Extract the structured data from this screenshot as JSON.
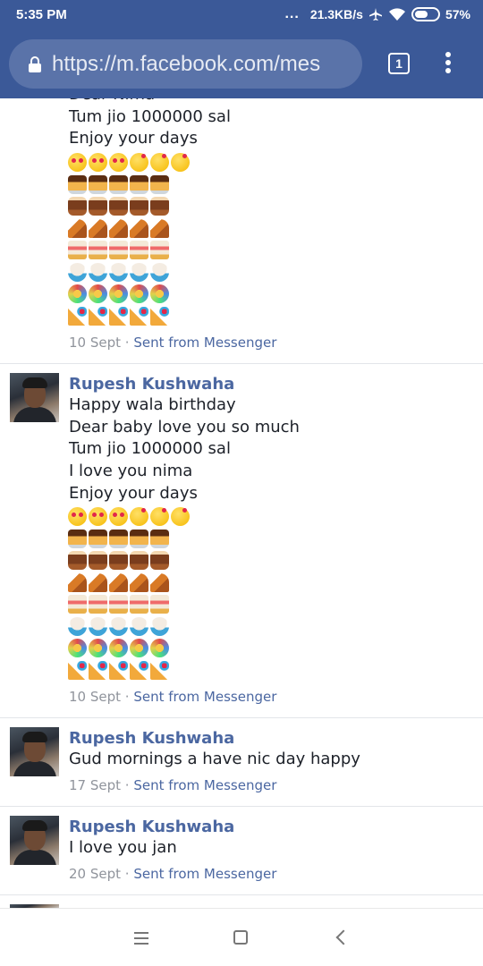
{
  "status_bar": {
    "time": "5:35 PM",
    "signal_dots": "...",
    "network_speed": "21.3KB/s",
    "battery": "57%",
    "battery_level": 0.57,
    "icons": [
      "airplane-icon",
      "wifi-icon",
      "battery-icon"
    ]
  },
  "browser": {
    "url": "https://m.facebook.com/mes",
    "tab_count": "1",
    "theme_color": "#3b5998"
  },
  "messages": [
    {
      "name": "",
      "lines": [
        "Dear Nima",
        "Tum jio 1000000 sal",
        "Enjoy your days"
      ],
      "meta_date": "10 Sept",
      "meta_sep": " · ",
      "meta_source": "Sent from Messenger"
    },
    {
      "name": "Rupesh Kushwaha",
      "lines": [
        "Happy wala birthday",
        "Dear baby love you so much",
        "Tum jio 1000000 sal",
        "I love you nima",
        "Enjoy your days"
      ],
      "meta_date": "10 Sept",
      "meta_sep": " · ",
      "meta_source": "Sent from Messenger"
    },
    {
      "name": "Rupesh Kushwaha",
      "lines": [
        "Gud mornings a have nic day happy"
      ],
      "meta_date": "17 Sept",
      "meta_sep": " · ",
      "meta_source": "Sent from Messenger"
    },
    {
      "name": "Rupesh Kushwaha",
      "lines": [
        "I love you jan"
      ],
      "meta_date": "20 Sept",
      "meta_sep": " · ",
      "meta_source": "Sent from Messenger"
    }
  ],
  "emoji_rows": [
    [
      "heart-eyes-face-icon",
      "heart-eyes-face-icon",
      "heart-eyes-face-icon",
      "kissing-face-icon",
      "kissing-face-icon",
      "kissing-face-icon"
    ],
    [
      "custard-icon",
      "custard-icon",
      "custard-icon",
      "custard-icon",
      "custard-icon"
    ],
    [
      "birthday-cake-icon",
      "birthday-cake-icon",
      "birthday-cake-icon",
      "birthday-cake-icon",
      "birthday-cake-icon"
    ],
    [
      "pie-slice-icon",
      "pie-slice-icon",
      "pie-slice-icon",
      "pie-slice-icon",
      "pie-slice-icon"
    ],
    [
      "shortcake-icon",
      "shortcake-icon",
      "shortcake-icon",
      "shortcake-icon",
      "shortcake-icon"
    ],
    [
      "shaved-ice-icon",
      "shaved-ice-icon",
      "shaved-ice-icon",
      "shaved-ice-icon",
      "shaved-ice-icon"
    ],
    [
      "partying-face-icon",
      "partying-face-icon",
      "partying-face-icon",
      "partying-face-icon",
      "partying-face-icon"
    ],
    [
      "party-popper-icon",
      "party-popper-icon",
      "party-popper-icon",
      "party-popper-icon",
      "party-popper-icon"
    ]
  ],
  "nav": {
    "icons": [
      "menu-icon",
      "home-icon",
      "back-icon"
    ]
  }
}
